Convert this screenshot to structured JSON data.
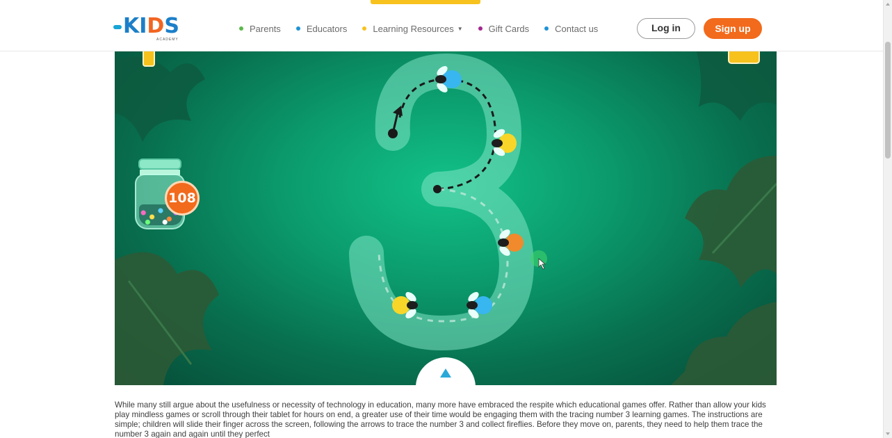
{
  "header": {
    "logo_text": "KIDS",
    "logo_sub": "ACADEMY",
    "nav": [
      {
        "label": "Parents",
        "dot_color": "#5bb84a"
      },
      {
        "label": "Educators",
        "dot_color": "#1e93d6"
      },
      {
        "label": "Learning Resources",
        "dot_color": "#f7c21d"
      },
      {
        "label": "Gift Cards",
        "dot_color": "#a4278f"
      },
      {
        "label": "Contact us",
        "dot_color": "#1e93d6"
      }
    ],
    "login_label": "Log in",
    "signup_label": "Sign up"
  },
  "game": {
    "jar_count": "108",
    "tracing_digit": "3"
  },
  "article": {
    "text": "While many still argue about the usefulness or necessity of technology in education, many more have embraced the respite which educational games offer. Rather than allow your kids play mindless games or scroll through their tablet for hours on end, a greater use of their time would be engaging them with the tracing number 3 learning games. The instructions are simple; children will slide their finger across the screen, following the arrows to trace the number 3 and collect fireflies. Before they move on, parents, they need to help them trace the number 3 again and again until they perfect"
  },
  "colors": {
    "accent_orange": "#f26a1b",
    "accent_yellow": "#f7c21d",
    "game_green": "#0b9a6c"
  }
}
